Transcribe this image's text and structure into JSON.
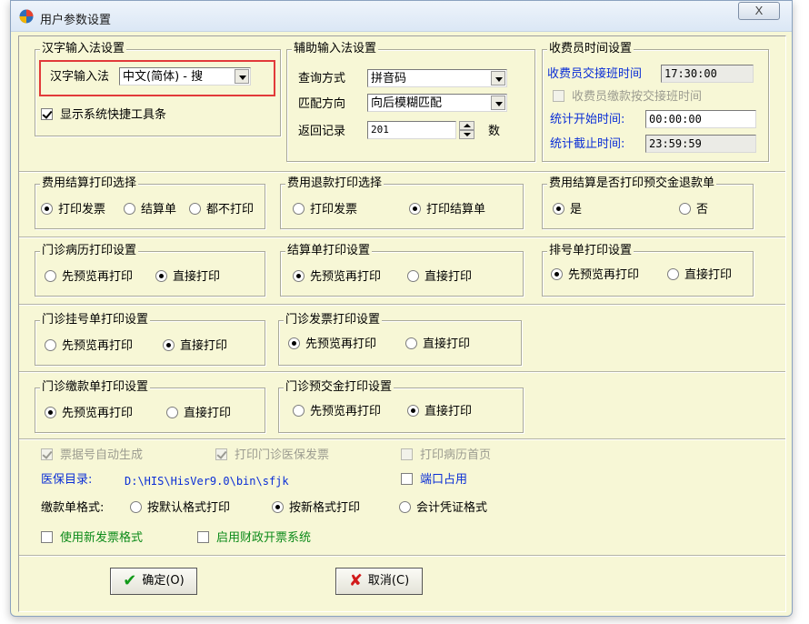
{
  "window": {
    "title": "用户参数设置",
    "close_label": "X"
  },
  "input_method": {
    "title": "汉字输入法设置",
    "label": "汉字输入法",
    "value": "中文(简体) - 搜",
    "show_toolbar_label": "显示系统快捷工具条"
  },
  "aux_input": {
    "title": "辅助输入法设置",
    "query_label": "查询方式",
    "query_value": "拼音码",
    "match_label": "匹配方向",
    "match_value": "向后模糊匹配",
    "return_label": "返回记录",
    "return_value": "201",
    "return_unit": "数"
  },
  "cashier": {
    "title": "收费员时间设置",
    "shift_label": "收费员交接班时间",
    "shift_value": "17:30:00",
    "pay_by_shift_label": "收费员缴款按交接班时间",
    "start_label": "统计开始时间:",
    "start_value": "00:00:00",
    "end_label": "统计截止时间:",
    "end_value": "23:59:59"
  },
  "settle_print": {
    "title": "费用结算打印选择",
    "options": [
      "打印发票",
      "结算单",
      "都不打印"
    ]
  },
  "refund_print": {
    "title": "费用退款打印选择",
    "options": [
      "打印发票",
      "打印结算单"
    ]
  },
  "prepay_refund": {
    "title": "费用结算是否打印预交金退款单",
    "options": [
      "是",
      "否"
    ]
  },
  "outpatient_record": {
    "title": "门诊病历打印设置",
    "options": [
      "先预览再打印",
      "直接打印"
    ]
  },
  "statement_print": {
    "title": "结算单打印设置",
    "options": [
      "先预览再打印",
      "直接打印"
    ]
  },
  "queue_print": {
    "title": "排号单打印设置",
    "options": [
      "先预览再打印",
      "直接打印"
    ]
  },
  "registration_print": {
    "title": "门诊挂号单打印设置",
    "options": [
      "先预览再打印",
      "直接打印"
    ]
  },
  "invoice_print": {
    "title": "门诊发票打印设置",
    "options": [
      "先预览再打印",
      "直接打印"
    ]
  },
  "payment_print": {
    "title": "门诊缴款单打印设置",
    "options": [
      "先预览再打印",
      "直接打印"
    ]
  },
  "prepay_print": {
    "title": "门诊预交金打印设置",
    "options": [
      "先预览再打印",
      "直接打印"
    ]
  },
  "misc": {
    "auto_number": "票据号自动生成",
    "print_insurance_invoice": "打印门诊医保发票",
    "print_record_first": "打印病历首页",
    "insurance_dir_label": "医保目录:",
    "insurance_dir_value": "D:\\HIS\\HisVer9.0\\bin\\sfjk",
    "port_busy": "端口占用",
    "payment_format_label": "缴款单格式:",
    "payment_formats": [
      "按默认格式打印",
      "按新格式打印",
      "会计凭证格式"
    ],
    "new_invoice_format": "使用新发票格式",
    "fiscal_invoice": "启用财政开票系统"
  },
  "buttons": {
    "ok": "确定(O)",
    "cancel": "取消(C)"
  },
  "colors": {
    "panel": "#f7f7d6",
    "accent_blue": "#0a2ed6",
    "accent_green": "#0b8a18",
    "highlight_red": "#e23a3a"
  }
}
